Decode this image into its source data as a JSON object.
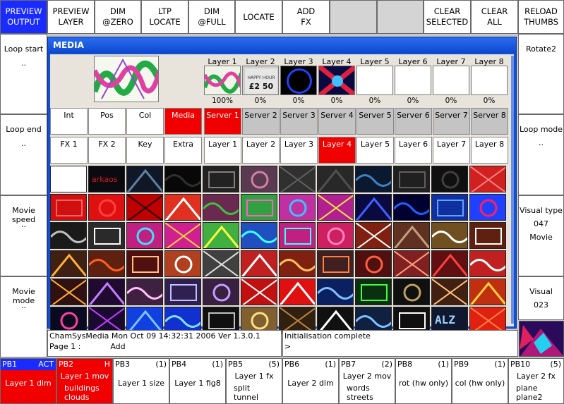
{
  "topbar": {
    "buttons": [
      {
        "l1": "PREVIEW",
        "l2": "OUTPUT"
      },
      {
        "l1": "PREVIEW",
        "l2": "LAYER"
      },
      {
        "l1": "DIM",
        "l2": "@ZERO"
      },
      {
        "l1": "LTP",
        "l2": "LOCATE"
      },
      {
        "l1": "DIM",
        "l2": "@FULL"
      },
      {
        "l1": "LOCATE",
        "l2": ""
      },
      {
        "l1": "ADD",
        "l2": "FX"
      },
      {
        "l1": "",
        "l2": ""
      },
      {
        "l1": "",
        "l2": ""
      },
      {
        "l1": "CLEAR",
        "l2": "SELECTED"
      },
      {
        "l1": "CLEAR",
        "l2": "ALL"
      },
      {
        "l1": "RELOAD",
        "l2": "THUMBS"
      }
    ]
  },
  "left": [
    {
      "label": "Loop start",
      "value": ".."
    },
    {
      "label": "Loop end",
      "value": ".."
    },
    {
      "label": "Movie speed",
      "value": ".."
    },
    {
      "label": "Movie mode",
      "value": ".."
    }
  ],
  "right": [
    {
      "label": "Rotate2",
      "value": "",
      "value2": ""
    },
    {
      "label": "Loop mode",
      "value": "..",
      "value2": ""
    },
    {
      "label": "Visual type",
      "value": "047",
      "value2": "Movie"
    },
    {
      "label": "Visual",
      "value": "023",
      "value2": ""
    }
  ],
  "media": {
    "title": "MEDIA",
    "layers": [
      {
        "name": "Layer 1",
        "pct": "100%"
      },
      {
        "name": "Layer 2",
        "pct": "0%"
      },
      {
        "name": "Layer 3",
        "pct": "0%"
      },
      {
        "name": "Layer 4",
        "pct": "0%"
      },
      {
        "name": "Layer 5",
        "pct": "0%"
      },
      {
        "name": "Layer 6",
        "pct": "0%"
      },
      {
        "name": "Layer 7",
        "pct": "0%"
      },
      {
        "name": "Layer 8",
        "pct": "0%"
      }
    ],
    "tabs_row1_left": [
      "Int",
      "Pos",
      "Col",
      "Media"
    ],
    "tabs_row1_right": [
      "Server 1",
      "Server 2",
      "Server 3",
      "Server 4",
      "Server 5",
      "Server 6",
      "Server 7",
      "Server 8"
    ],
    "tabs_row2_left": [
      "FX 1",
      "FX 2",
      "Key",
      "Extra"
    ],
    "tabs_row2_right": [
      "Layer 1",
      "Layer 2",
      "Layer 3",
      "Layer 4",
      "Layer 5",
      "Layer 6",
      "Layer 7",
      "Layer 8"
    ],
    "active_tab": "Media",
    "active_server": "Server 1",
    "active_layer": "Layer 4",
    "thumb_text": {
      "arkaos": "arkaos",
      "alz": "ALZ",
      "price": "£2 50"
    }
  },
  "status": {
    "line1": "ChamSysMedia  Mon Oct 09 14:32:31 2006  Ver 1.3.0.1",
    "page_label": "Page 1 :",
    "page_value": "Add",
    "message": "Initialisation complete",
    "prompt": ">"
  },
  "playbacks": [
    {
      "num": "PB1",
      "count": "ACT",
      "label": "Layer 1 dim",
      "sub": [],
      "state": "act"
    },
    {
      "num": "PB2",
      "count": "H",
      "label": "Layer 1 mov",
      "sub": [
        "buildings",
        "clouds"
      ],
      "state": "red"
    },
    {
      "num": "PB3",
      "count": "(1)",
      "label": "Layer 1 size",
      "sub": [],
      "state": ""
    },
    {
      "num": "PB4",
      "count": "(1)",
      "label": "Layer 1 fig8",
      "sub": [],
      "state": ""
    },
    {
      "num": "PB5",
      "count": "(5)",
      "label": "Layer 1 fx",
      "sub": [
        "split",
        "tunnel"
      ],
      "state": ""
    },
    {
      "num": "PB6",
      "count": "(1)",
      "label": "Layer 2 dim",
      "sub": [],
      "state": ""
    },
    {
      "num": "PB7",
      "count": "(2)",
      "label": "Layer 2 mov",
      "sub": [
        "words",
        "streets"
      ],
      "state": ""
    },
    {
      "num": "PB8",
      "count": "(1)",
      "label": "rot (hw only)",
      "sub": [],
      "state": ""
    },
    {
      "num": "PB9",
      "count": "(1)",
      "label": "col (hw only)",
      "sub": [],
      "state": ""
    },
    {
      "num": "PB10",
      "count": "(5)",
      "label": "Layer 2 fx",
      "sub": [
        "plane",
        "plane2"
      ],
      "state": ""
    }
  ],
  "colors": {
    "active_red": "#f00000",
    "active_blue": "#1a2bff",
    "window_blue": "#1050d8"
  }
}
